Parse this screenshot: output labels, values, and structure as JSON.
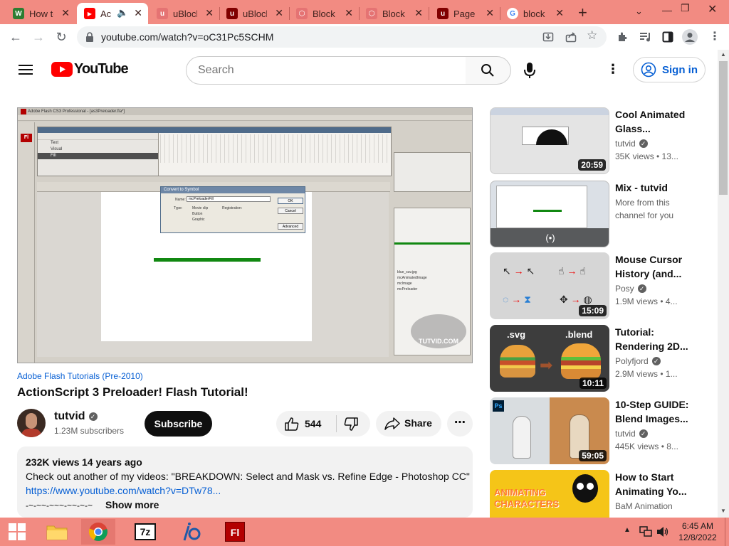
{
  "browser": {
    "tabs": [
      {
        "title": "How to",
        "favicon_color": "#2e7d32",
        "favicon_glyph": "W"
      },
      {
        "title": "Ac",
        "favicon_color": "#ff0000",
        "favicon_glyph": "▶"
      },
      {
        "title": "uBlock",
        "favicon_color": "#e57373",
        "favicon_glyph": "u"
      },
      {
        "title": "uBlock",
        "favicon_color": "#800000",
        "favicon_glyph": "u"
      },
      {
        "title": "Block",
        "favicon_color": "#e57373",
        "favicon_glyph": "⬡"
      },
      {
        "title": "Block",
        "favicon_color": "#e57373",
        "favicon_glyph": "⬡"
      },
      {
        "title": "Page",
        "favicon_color": "#800000",
        "favicon_glyph": "u"
      },
      {
        "title": "block",
        "favicon_color": "#4285f4",
        "favicon_glyph": "G"
      }
    ],
    "active_tab_index": 1,
    "url": "youtube.com/watch?v=oC31Pc5SCHM"
  },
  "youtube": {
    "logo_text": "YouTube",
    "search_placeholder": "Search",
    "signin_label": "Sign in",
    "video": {
      "category": "Adobe Flash Tutorials (Pre-2010)",
      "title": "ActionScript 3 Preloader! Flash Tutorial!",
      "channel": "tutvid",
      "subscribers": "1.23M subscribers",
      "subscribe_label": "Subscribe",
      "likes": "544",
      "share_label": "Share",
      "views": "232K views",
      "age": "14 years ago",
      "description": "Check out another of my videos: \"BREAKDOWN: Select and Mask vs. Refine Edge - Photoshop CC\"",
      "link": "https://www.youtube.com/watch?v=DTw78...",
      "divider": "-~-~~-~~~-~~-~-~",
      "show_more": "Show more"
    },
    "player_content": {
      "app_title": "Adobe Flash CS3 Professional - [as3Preloader.fla*]",
      "layers": [
        "Text",
        "Visual",
        "Fill"
      ],
      "dialog_title": "Convert to Symbol",
      "dialog_name_label": "Name:",
      "dialog_name_value": "mcPreloaderFill",
      "dialog_type_label": "Type:",
      "dialog_types": [
        "Movie clip",
        "Button",
        "Graphic"
      ],
      "dialog_registration": "Registration:",
      "dialog_ok": "OK",
      "dialog_cancel": "Cancel",
      "dialog_advanced": "Advanced",
      "library_items": [
        "blue_suv.jpg",
        "mcAnimatedImage",
        "mcImage",
        "mcPreloader"
      ],
      "watermark": "TUTVID.COM"
    },
    "recommended": [
      {
        "title": "Cool Animated Glass...",
        "channel": "tutvid",
        "verified": true,
        "meta": "35K views • 13...",
        "duration": "20:59"
      },
      {
        "title": "Mix - tutvid",
        "channel": "More from this",
        "verified": false,
        "meta": "channel for you",
        "duration": "(•)"
      },
      {
        "title": "Mouse Cursor History (and...",
        "channel": "Posy",
        "verified": true,
        "meta": "1.9M views • 4...",
        "duration": "15:09"
      },
      {
        "title": "Tutorial: Rendering 2D...",
        "channel": "Polyfjord",
        "verified": true,
        "meta": "2.9M views • 1...",
        "duration": "10:11",
        "thumb_labels": [
          ".svg",
          ".blend"
        ]
      },
      {
        "title": "10-Step GUIDE: Blend Images...",
        "channel": "tutvid",
        "verified": true,
        "meta": "445K views • 8...",
        "duration": "59:05",
        "thumb_badge": "Ps"
      },
      {
        "title": "How to Start Animating Yo...",
        "channel": "BaM Animation",
        "verified": false,
        "meta": "",
        "duration": "",
        "thumb_text": "ANIMATING CHARACTERS"
      }
    ]
  },
  "taskbar": {
    "time": "6:45 AM",
    "date": "12/8/2022",
    "apps": [
      "windows-start",
      "file-explorer",
      "chrome",
      "7zip",
      "tool-app",
      "flash"
    ],
    "flash_label": "Fl",
    "zip_label": "7z"
  },
  "colors": {
    "chrome_frame": "#f28b82",
    "youtube_red": "#ff0000",
    "link_blue": "#065fd4",
    "flash_red": "#b30000"
  }
}
